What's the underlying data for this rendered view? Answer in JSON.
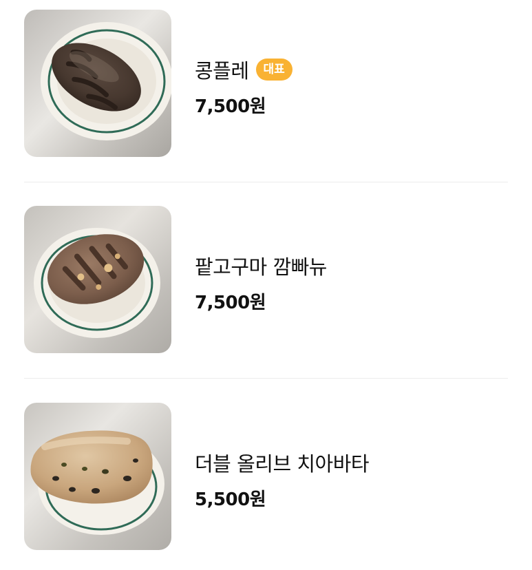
{
  "items": [
    {
      "name": "콩플레",
      "badge": "대표",
      "price": "7,500원",
      "image": "dark-rye-loaf-on-plate"
    },
    {
      "name": "팥고구마 깜빠뉴",
      "badge": "",
      "price": "7,500원",
      "image": "campagne-loaf-on-plate"
    },
    {
      "name": "더블 올리브 치아바타",
      "badge": "",
      "price": "5,500원",
      "image": "olive-ciabatta-on-plate"
    }
  ],
  "colors": {
    "badge_bg": "#f9b233",
    "badge_text": "#ffffff",
    "divider": "#ececec",
    "plate_rim": "#2f6b57"
  }
}
